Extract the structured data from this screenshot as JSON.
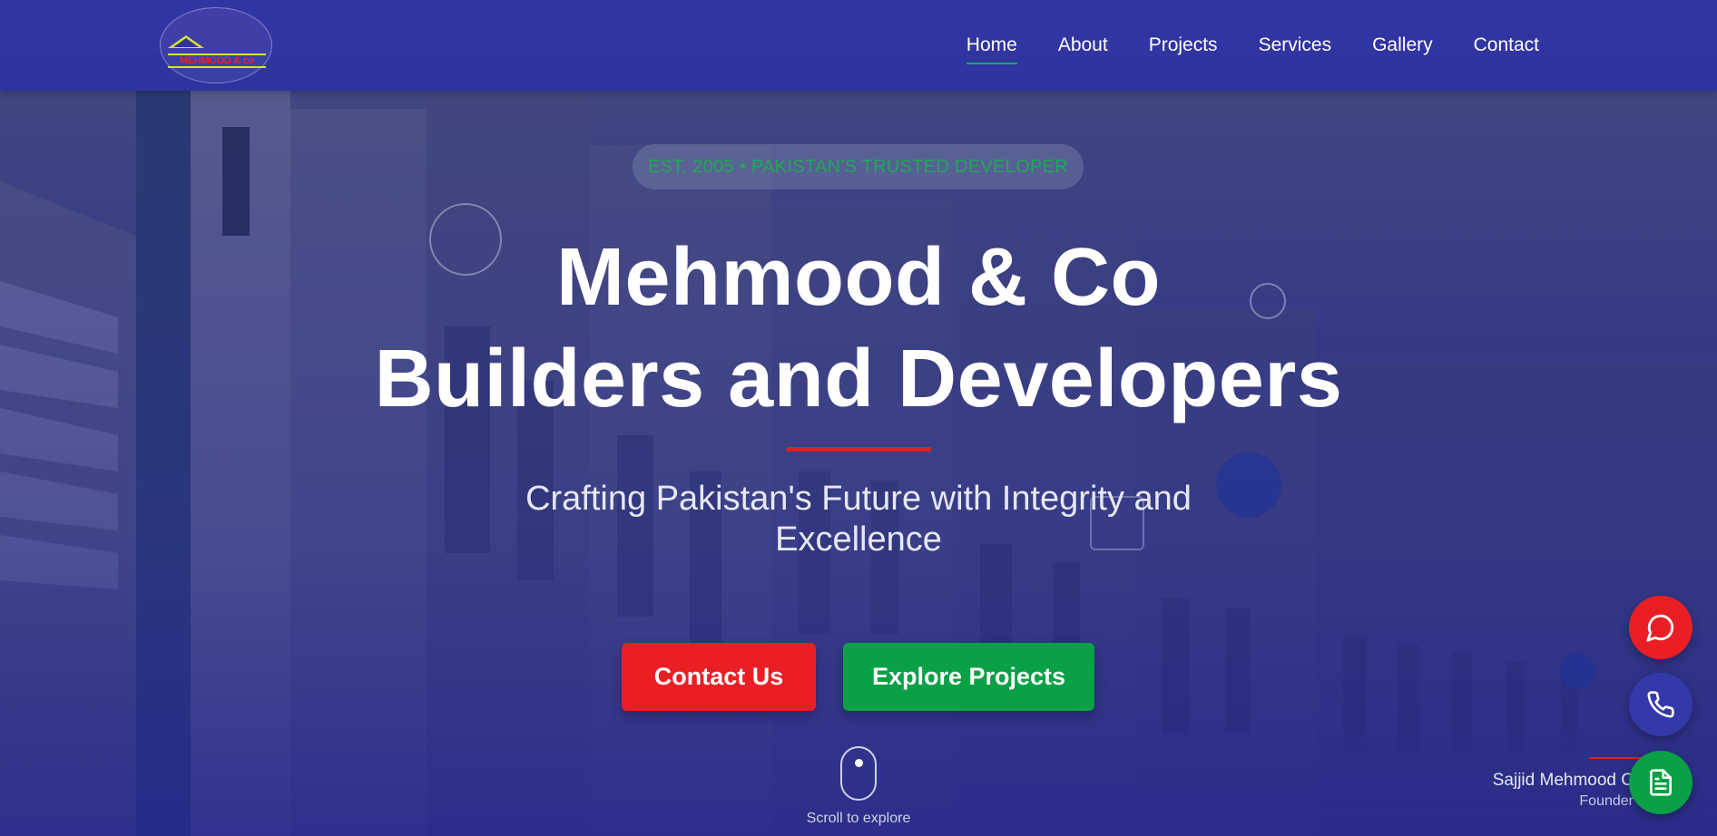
{
  "nav": {
    "logo_text": "MEHMOOD & co",
    "links": [
      {
        "label": "Home",
        "active": true
      },
      {
        "label": "About"
      },
      {
        "label": "Projects"
      },
      {
        "label": "Services"
      },
      {
        "label": "Gallery"
      },
      {
        "label": "Contact"
      }
    ]
  },
  "hero": {
    "badge": "EST. 2005 • PAKISTAN'S TRUSTED DEVELOPER",
    "title_line1": "Mehmood & Co",
    "title_line2": "Builders and Developers",
    "subtitle_line1": "Crafting Pakistan's Future with Integrity and",
    "subtitle_line2": "Excellence",
    "contact_button": "Contact Us",
    "explore_button": "Explore Projects",
    "scroll_hint": "Scroll to explore"
  },
  "founder": {
    "name": "Sajjid Mehmood C",
    "role": "Founder"
  },
  "floating_actions": [
    {
      "icon": "chat-icon",
      "color": "#ea1f25"
    },
    {
      "icon": "phone-icon",
      "color": "#3438a8"
    },
    {
      "icon": "document-icon",
      "color": "#09a046"
    }
  ],
  "colors": {
    "nav_bg": "#2f33a0",
    "accent_red": "#e01f26",
    "accent_green": "#09a046"
  }
}
